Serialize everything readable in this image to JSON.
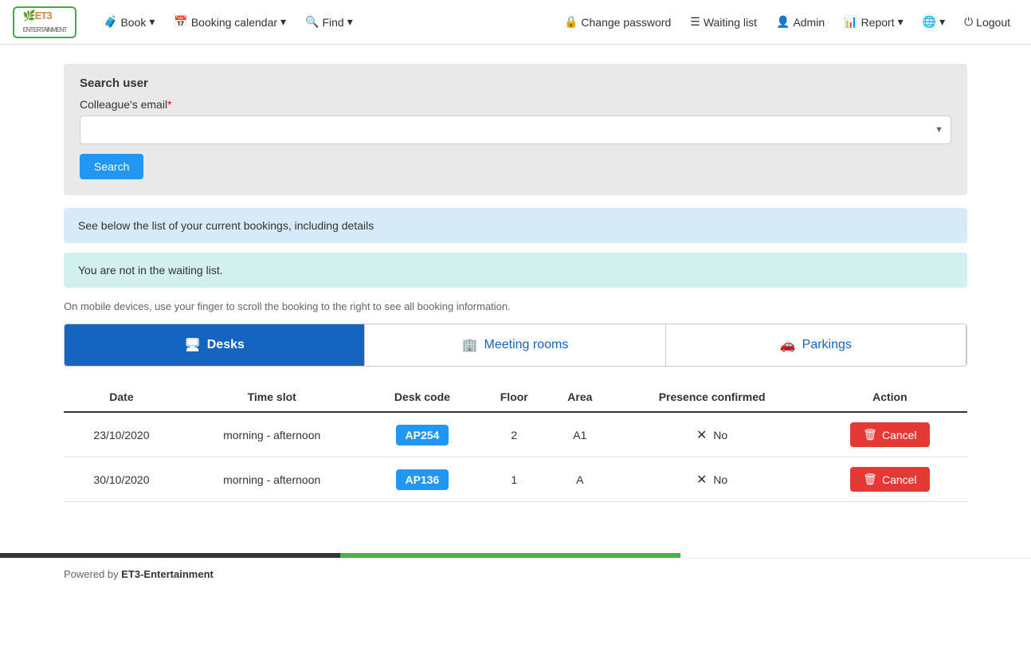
{
  "brand": {
    "logo_text": "ET3",
    "logo_sub": "ENTERTAINMENT"
  },
  "nav": {
    "left": [
      {
        "id": "book",
        "label": "Book",
        "icon": "🧳",
        "has_dropdown": true
      },
      {
        "id": "booking-calendar",
        "label": "Booking calendar",
        "icon": "📅",
        "has_dropdown": true
      },
      {
        "id": "find",
        "label": "Find",
        "icon": "🔍",
        "has_dropdown": true
      }
    ],
    "right": [
      {
        "id": "change-password",
        "label": "Change password",
        "icon": "🔒"
      },
      {
        "id": "waiting-list",
        "label": "Waiting list",
        "icon": "☰"
      },
      {
        "id": "admin",
        "label": "Admin",
        "icon": "👤"
      },
      {
        "id": "report",
        "label": "Report",
        "icon": "📊",
        "has_dropdown": true
      },
      {
        "id": "language",
        "label": "",
        "icon": "🌐",
        "has_dropdown": true
      },
      {
        "id": "logout",
        "label": "Logout",
        "icon": "⏻"
      }
    ]
  },
  "search_user": {
    "title": "Search user",
    "field_label": "Colleague's email",
    "field_required": true,
    "placeholder": "",
    "button_label": "Search"
  },
  "banners": {
    "info": "See below the list of your current bookings, including details",
    "waiting": "You are not in the waiting list."
  },
  "mobile_note": "On mobile devices, use your finger to scroll the booking to the right to see all booking information.",
  "tabs": [
    {
      "id": "desks",
      "label": "Desks",
      "icon": "🖥",
      "active": true
    },
    {
      "id": "meeting-rooms",
      "label": "Meeting rooms",
      "icon": "🏢",
      "active": false
    },
    {
      "id": "parkings",
      "label": "Parkings",
      "icon": "🚗",
      "active": false
    }
  ],
  "table": {
    "headers": [
      "Date",
      "Time slot",
      "Desk code",
      "Floor",
      "Area",
      "Presence confirmed",
      "Action"
    ],
    "rows": [
      {
        "date": "23/10/2020",
        "time_slot": "morning - afternoon",
        "desk_code": "AP254",
        "floor": "2",
        "area": "A1",
        "presence": "No",
        "action": "Cancel"
      },
      {
        "date": "30/10/2020",
        "time_slot": "morning - afternoon",
        "desk_code": "AP136",
        "floor": "1",
        "area": "A",
        "presence": "No",
        "action": "Cancel"
      }
    ]
  },
  "footer": {
    "powered_by": "Powered by ",
    "brand": "ET3-Entertainment"
  }
}
